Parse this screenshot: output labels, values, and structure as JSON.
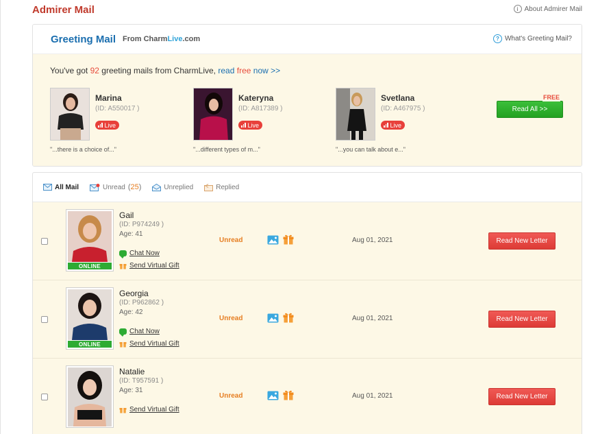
{
  "page": {
    "title": "Admirer Mail",
    "about_link": "About Admirer Mail"
  },
  "greeting": {
    "title": "Greeting Mail",
    "from_prefix": "From",
    "brand_charm": "Charm",
    "brand_live": "Live",
    "brand_suffix": ".com",
    "whats_link": "What's Greeting Mail?",
    "msg_prefix": "You've got",
    "msg_count": "92",
    "msg_suffix": "greeting mails from CharmLive,",
    "msg_read": "read",
    "msg_free": "free",
    "msg_now": "now >>",
    "girls": [
      {
        "name": "Marina",
        "id": "(ID: A550017 )",
        "live": "Live",
        "quote": "\"...there is a choice of...\""
      },
      {
        "name": "Kateryna",
        "id": "(ID: A817389 )",
        "live": "Live",
        "quote": "\"...different types of m...\""
      },
      {
        "name": "Svetlana",
        "id": "(ID: A467975 )",
        "live": "Live",
        "quote": "\"...you can talk about e...\""
      }
    ],
    "free_tag": "FREE",
    "read_all_label": "Read All >>"
  },
  "tabs": {
    "all": "All Mail",
    "unread": "Unread",
    "unread_open": "(",
    "unread_count": "25",
    "unread_close": ")",
    "unreplied": "Unreplied",
    "replied": "Replied"
  },
  "mails": [
    {
      "name": "Gail",
      "id": "(ID: P974249 )",
      "age": "Age: 41",
      "online": "ONLINE",
      "chat": "Chat Now",
      "gift": "Send Virtual Gift",
      "status": "Unread",
      "date": "Aug 01, 2021",
      "action": "Read New Letter"
    },
    {
      "name": "Georgia",
      "id": "(ID: P962862 )",
      "age": "Age: 42",
      "online": "ONLINE",
      "chat": "Chat Now",
      "gift": "Send Virtual Gift",
      "status": "Unread",
      "date": "Aug 01, 2021",
      "action": "Read New Letter"
    },
    {
      "name": "Natalie",
      "id": "(ID: T957591 )",
      "age": "Age: 31",
      "gift": "Send Virtual Gift",
      "status": "Unread",
      "date": "Aug 01, 2021",
      "action": "Read New Letter"
    }
  ],
  "colors": {
    "brand_red": "#c0392b",
    "brand_blue": "#1a6eaf",
    "panel_cream": "#fdf8e6",
    "green_button": "#2eab33",
    "red_button": "#e8403a",
    "status_orange": "#e67e22"
  },
  "icons": {
    "about": "info-circle-icon",
    "whats": "question-circle-icon",
    "live": "signal-bars-icon",
    "all_mail": "envelope-icon",
    "unread": "envelope-dot-icon",
    "unreplied": "envelope-open-icon",
    "replied": "reply-icon",
    "chat": "chat-bubble-icon",
    "gift": "gift-icon",
    "photo": "picture-icon"
  }
}
